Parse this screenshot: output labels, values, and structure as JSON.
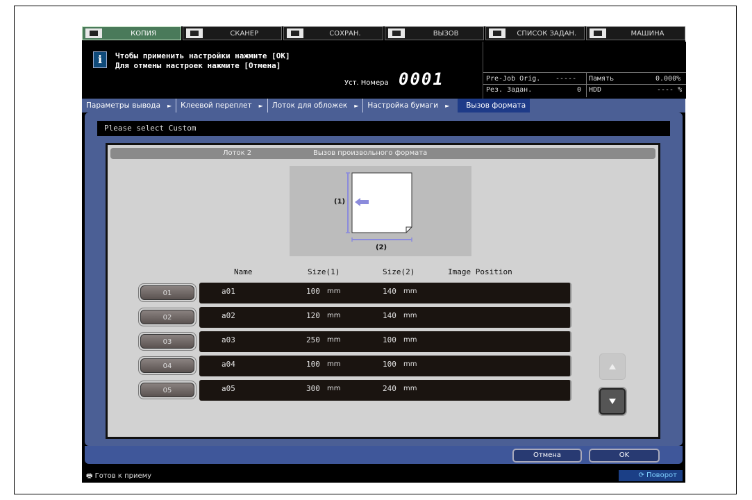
{
  "tabs": [
    {
      "label": "КОПИЯ",
      "icon": "copy-icon",
      "active": true
    },
    {
      "label": "СКАНЕР",
      "icon": "scanner-icon",
      "active": false
    },
    {
      "label": "СОХРАН.",
      "icon": "save-icon",
      "active": false
    },
    {
      "label": "ВЫЗОВ",
      "icon": "recall-icon",
      "active": false
    },
    {
      "label": "СПИСОК ЗАДАН.",
      "icon": "job-list-icon",
      "active": false
    },
    {
      "label": "МАШИНА",
      "icon": "machine-icon",
      "active": false
    }
  ],
  "message": {
    "line1": "Чтобы применить настройки нажмите [OK]",
    "line2": "Для отмены настроек нажмите [Отмена]",
    "counter_label": "Уст. Номера",
    "counter_value": "0001"
  },
  "status": {
    "prejob_label": "Pre-Job Orig.",
    "prejob_value": "-----",
    "jobs_label": "Рез. Задан.",
    "jobs_value": "0",
    "memory_label": "Память",
    "memory_value": "0.000%",
    "hdd_label": "HDD",
    "hdd_value": "---- %"
  },
  "breadcrumb": [
    "Параметры вывода",
    "Клеевой переплет",
    "Лоток для обложек",
    "Настройка бумаги",
    "Вызов формата"
  ],
  "panel_title": "Please select Custom",
  "dialog": {
    "tray": "Лоток 2",
    "title": "Вызов произвольного формата",
    "figure_label1": "(1)",
    "figure_label2": "(2)"
  },
  "columns": {
    "name": "Name",
    "size1": "Size(1)",
    "size2": "Size(2)",
    "image_position": "Image Position"
  },
  "rows": [
    {
      "button": "01",
      "name": "a01",
      "size1": "100",
      "size2": "140",
      "unit": "mm"
    },
    {
      "button": "02",
      "name": "a02",
      "size1": "120",
      "size2": "140",
      "unit": "mm"
    },
    {
      "button": "03",
      "name": "a03",
      "size1": "250",
      "size2": "100",
      "unit": "mm"
    },
    {
      "button": "04",
      "name": "a04",
      "size1": "100",
      "size2": "100",
      "unit": "mm"
    },
    {
      "button": "05",
      "name": "a05",
      "size1": "300",
      "size2": "240",
      "unit": "mm"
    }
  ],
  "buttons": {
    "cancel": "Отмена",
    "ok": "OK"
  },
  "footer": {
    "ready": "Готов к приему",
    "rotate": "Поворот"
  },
  "colors": {
    "accent": "#4b5f95",
    "active_tab": "#4a7a5a",
    "arrow": "#8b8bdc"
  }
}
